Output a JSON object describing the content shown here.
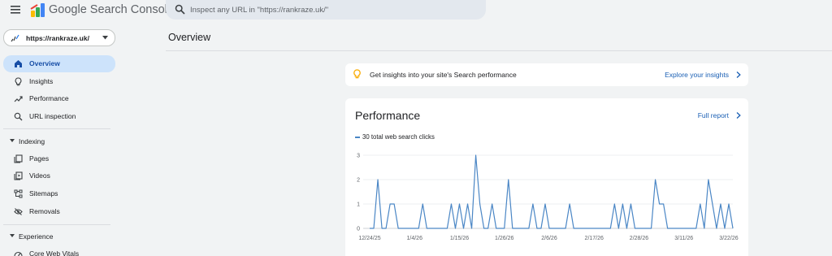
{
  "app": {
    "title": "Google Search Console"
  },
  "search": {
    "placeholder": "Inspect any URL in \"https://rankraze.uk/\""
  },
  "property": {
    "label": "https://rankraze.uk/"
  },
  "sidebar": {
    "items": [
      {
        "label": "Overview",
        "icon": "home-icon",
        "active": true
      },
      {
        "label": "Insights",
        "icon": "lightbulb-icon"
      },
      {
        "label": "Performance",
        "icon": "trending-up-icon"
      },
      {
        "label": "URL inspection",
        "icon": "search-icon"
      }
    ],
    "sections": [
      {
        "label": "Indexing",
        "items": [
          {
            "label": "Pages",
            "icon": "pages-icon"
          },
          {
            "label": "Videos",
            "icon": "video-icon"
          },
          {
            "label": "Sitemaps",
            "icon": "sitemap-icon"
          },
          {
            "label": "Removals",
            "icon": "removals-icon"
          }
        ]
      },
      {
        "label": "Experience",
        "items": [
          {
            "label": "Core Web Vitals",
            "icon": "speed-icon"
          }
        ]
      }
    ]
  },
  "main": {
    "title": "Overview",
    "insights": {
      "text": "Get insights into your site's Search performance",
      "link": "Explore your insights"
    },
    "performance": {
      "title": "Performance",
      "link": "Full report"
    }
  },
  "colors": {
    "accent": "#1a5fb4",
    "line": "#4a86c5",
    "active_nav": "#cde3fb",
    "bulb": "#f9ab00"
  },
  "chart_data": {
    "type": "line",
    "series": [
      {
        "name": "30 total web search clicks"
      }
    ],
    "x_ticks": [
      "12/24/25",
      "1/4/26",
      "1/15/26",
      "1/26/26",
      "2/6/26",
      "2/17/26",
      "2/28/26",
      "3/11/26",
      "3/22/26"
    ],
    "y_ticks": [
      0,
      1,
      2,
      3
    ],
    "ylim": [
      0,
      3
    ],
    "x_start": "2025-12-24",
    "x_end": "2026-03-23",
    "points": [
      [
        "2025-12-24",
        0
      ],
      [
        "2025-12-25",
        0
      ],
      [
        "2025-12-26",
        2
      ],
      [
        "2025-12-27",
        0
      ],
      [
        "2025-12-28",
        0
      ],
      [
        "2025-12-29",
        1
      ],
      [
        "2025-12-30",
        1
      ],
      [
        "2025-12-31",
        0
      ],
      [
        "2026-01-01",
        0
      ],
      [
        "2026-01-02",
        0
      ],
      [
        "2026-01-03",
        0
      ],
      [
        "2026-01-04",
        0
      ],
      [
        "2026-01-05",
        0
      ],
      [
        "2026-01-06",
        1
      ],
      [
        "2026-01-07",
        0
      ],
      [
        "2026-01-08",
        0
      ],
      [
        "2026-01-09",
        0
      ],
      [
        "2026-01-10",
        0
      ],
      [
        "2026-01-11",
        0
      ],
      [
        "2026-01-12",
        0
      ],
      [
        "2026-01-13",
        1
      ],
      [
        "2026-01-14",
        0
      ],
      [
        "2026-01-15",
        1
      ],
      [
        "2026-01-16",
        0
      ],
      [
        "2026-01-17",
        1
      ],
      [
        "2026-01-18",
        0
      ],
      [
        "2026-01-19",
        3
      ],
      [
        "2026-01-20",
        1
      ],
      [
        "2026-01-21",
        0
      ],
      [
        "2026-01-22",
        0
      ],
      [
        "2026-01-23",
        1
      ],
      [
        "2026-01-24",
        0
      ],
      [
        "2026-01-25",
        0
      ],
      [
        "2026-01-26",
        0
      ],
      [
        "2026-01-27",
        2
      ],
      [
        "2026-01-28",
        0
      ],
      [
        "2026-01-29",
        0
      ],
      [
        "2026-01-30",
        0
      ],
      [
        "2026-01-31",
        0
      ],
      [
        "2026-02-01",
        0
      ],
      [
        "2026-02-02",
        1
      ],
      [
        "2026-02-03",
        0
      ],
      [
        "2026-02-04",
        0
      ],
      [
        "2026-02-05",
        1
      ],
      [
        "2026-02-06",
        0
      ],
      [
        "2026-02-07",
        0
      ],
      [
        "2026-02-08",
        0
      ],
      [
        "2026-02-09",
        0
      ],
      [
        "2026-02-10",
        0
      ],
      [
        "2026-02-11",
        1
      ],
      [
        "2026-02-12",
        0
      ],
      [
        "2026-02-13",
        0
      ],
      [
        "2026-02-14",
        0
      ],
      [
        "2026-02-15",
        0
      ],
      [
        "2026-02-16",
        0
      ],
      [
        "2026-02-17",
        0
      ],
      [
        "2026-02-18",
        0
      ],
      [
        "2026-02-19",
        0
      ],
      [
        "2026-02-20",
        0
      ],
      [
        "2026-02-21",
        0
      ],
      [
        "2026-02-22",
        1
      ],
      [
        "2026-02-23",
        0
      ],
      [
        "2026-02-24",
        1
      ],
      [
        "2026-02-25",
        0
      ],
      [
        "2026-02-26",
        1
      ],
      [
        "2026-02-27",
        0
      ],
      [
        "2026-02-28",
        0
      ],
      [
        "2026-03-01",
        0
      ],
      [
        "2026-03-02",
        0
      ],
      [
        "2026-03-03",
        0
      ],
      [
        "2026-03-04",
        2
      ],
      [
        "2026-03-05",
        1
      ],
      [
        "2026-03-06",
        1
      ],
      [
        "2026-03-07",
        0
      ],
      [
        "2026-03-08",
        0
      ],
      [
        "2026-03-09",
        0
      ],
      [
        "2026-03-10",
        0
      ],
      [
        "2026-03-11",
        0
      ],
      [
        "2026-03-12",
        0
      ],
      [
        "2026-03-13",
        0
      ],
      [
        "2026-03-14",
        0
      ],
      [
        "2026-03-15",
        1
      ],
      [
        "2026-03-16",
        0
      ],
      [
        "2026-03-17",
        2
      ],
      [
        "2026-03-18",
        1
      ],
      [
        "2026-03-19",
        0
      ],
      [
        "2026-03-20",
        1
      ],
      [
        "2026-03-21",
        0
      ],
      [
        "2026-03-22",
        1
      ],
      [
        "2026-03-23",
        0
      ]
    ],
    "grid": true,
    "legend": "top-left"
  }
}
